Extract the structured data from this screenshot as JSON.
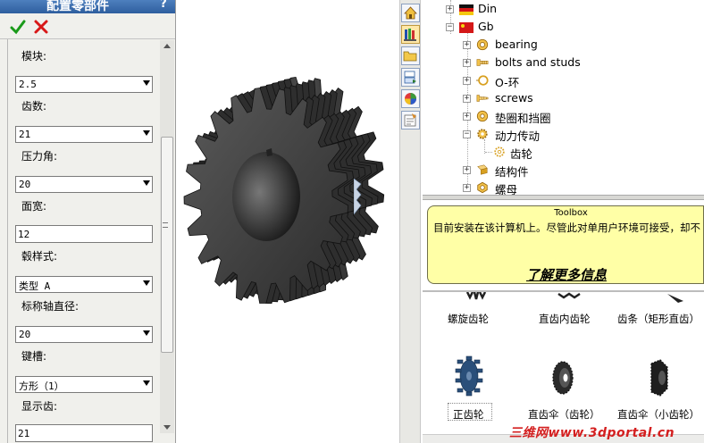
{
  "property_manager": {
    "title": "配置零部件",
    "help_label": "?",
    "fields": [
      {
        "label": "模块:",
        "value": "2.5",
        "kind": "select"
      },
      {
        "label": "齿数:",
        "value": "21",
        "kind": "select"
      },
      {
        "label": "压力角:",
        "value": "20",
        "kind": "select"
      },
      {
        "label": "面宽:",
        "value": "12",
        "kind": "input"
      },
      {
        "label": "毂样式:",
        "value": "类型 A",
        "kind": "select"
      },
      {
        "label": "标称轴直径:",
        "value": "20",
        "kind": "select"
      },
      {
        "label": "键槽:",
        "value": "方形（1）",
        "kind": "select"
      },
      {
        "label": "显示齿:",
        "value": "21",
        "kind": "input"
      }
    ]
  },
  "task_pane_icons": [
    "home-icon",
    "design-library-icon",
    "file-explorer-icon",
    "search-icon",
    "appearances-icon",
    "custom-properties-icon"
  ],
  "tree": {
    "nodes": [
      {
        "label": "Din",
        "icon": "flag-de-icon"
      },
      {
        "label": "Gb",
        "icon": "flag-cn-icon"
      },
      {
        "label": "bearing",
        "icon": "bearing-icon"
      },
      {
        "label": "bolts and studs",
        "icon": "bolt-icon"
      },
      {
        "label": "O-环",
        "icon": "o-ring-icon"
      },
      {
        "label": "screws",
        "icon": "screw-icon"
      },
      {
        "label": "垫圈和挡圈",
        "icon": "washer-icon"
      },
      {
        "label": "动力传动",
        "icon": "power-transmission-icon"
      },
      {
        "label": "齿轮",
        "icon": "gear-icon"
      },
      {
        "label": "结构件",
        "icon": "structural-icon"
      },
      {
        "label": "螺母",
        "icon": "nut-icon"
      }
    ]
  },
  "tooltip": {
    "title": "Toolbox",
    "message": "目前安装在该计算机上。尽管此对单用户环境可接受，却不",
    "link": "了解更多信息"
  },
  "gallery": {
    "top_row": [
      "螺旋齿轮",
      "直齿内齿轮",
      "齿条（矩形直齿）"
    ],
    "bottom_row": [
      "正齿轮",
      "直齿伞（齿轮）",
      "直齿伞（小齿轮）"
    ]
  },
  "watermark": "三维网www.3dportal.cn",
  "colors": {
    "title_bar": "#3a6aa8",
    "tooltip_bg": "#ffffa6",
    "gear": "#3a3a3a",
    "gallery_spur_gear": "#2a4f7a"
  }
}
